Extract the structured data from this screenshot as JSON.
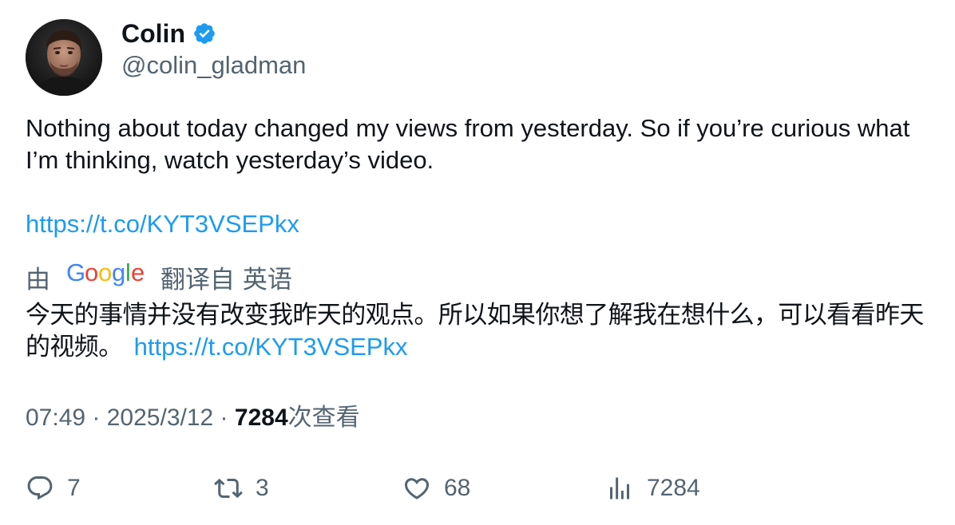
{
  "author": {
    "display_name": "Colin",
    "handle": "@colin_gladman",
    "verified_icon": "verified-badge-icon",
    "avatar_icon": "avatar-photo"
  },
  "tweet": {
    "text_line1": "Nothing about today changed my views from yesterday. So if you’re curious what I’m thinking, watch yesterday’s video.",
    "link": "https://t.co/KYT3VSEPkx"
  },
  "translation": {
    "prefix": "由",
    "provider": "Google",
    "suffix": "翻译自 英语",
    "text": "今天的事情并没有改变我昨天的观点。所以如果你想了解我在想什么，可以看看昨天的视频。",
    "link": "https://t.co/KYT3VSEPkx"
  },
  "meta": {
    "time": "07:49",
    "separator": " · ",
    "date": "2025/3/12",
    "views_count": "7284",
    "views_label": "次查看"
  },
  "actions": {
    "replies": "7",
    "retweets": "3",
    "likes": "68",
    "views": "7284"
  },
  "colors": {
    "link": "#1d9bf0",
    "secondary_text": "#536471",
    "primary_text": "#0f1419",
    "verified": "#1d9bf0"
  }
}
